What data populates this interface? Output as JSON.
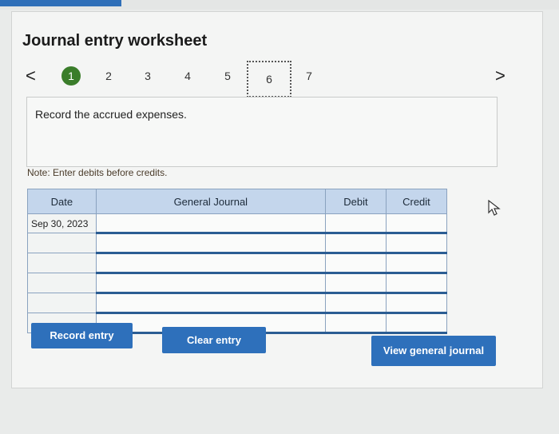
{
  "title": "Journal entry worksheet",
  "nav": {
    "prev": "<",
    "next": ">"
  },
  "steps": [
    "1",
    "2",
    "3",
    "4",
    "5",
    "6",
    "7"
  ],
  "prompt": "Record the accrued expenses.",
  "note": "Note: Enter debits before credits.",
  "table": {
    "headers": [
      "Date",
      "General Journal",
      "Debit",
      "Credit"
    ],
    "rows": [
      [
        "Sep 30, 2023",
        "",
        "",
        ""
      ],
      [
        "",
        "",
        "",
        ""
      ],
      [
        "",
        "",
        "",
        ""
      ],
      [
        "",
        "",
        "",
        ""
      ],
      [
        "",
        "",
        "",
        ""
      ],
      [
        "",
        "",
        "",
        ""
      ]
    ]
  },
  "buttons": {
    "record": "Record entry",
    "clear": "Clear entry",
    "view": "View general journal"
  }
}
